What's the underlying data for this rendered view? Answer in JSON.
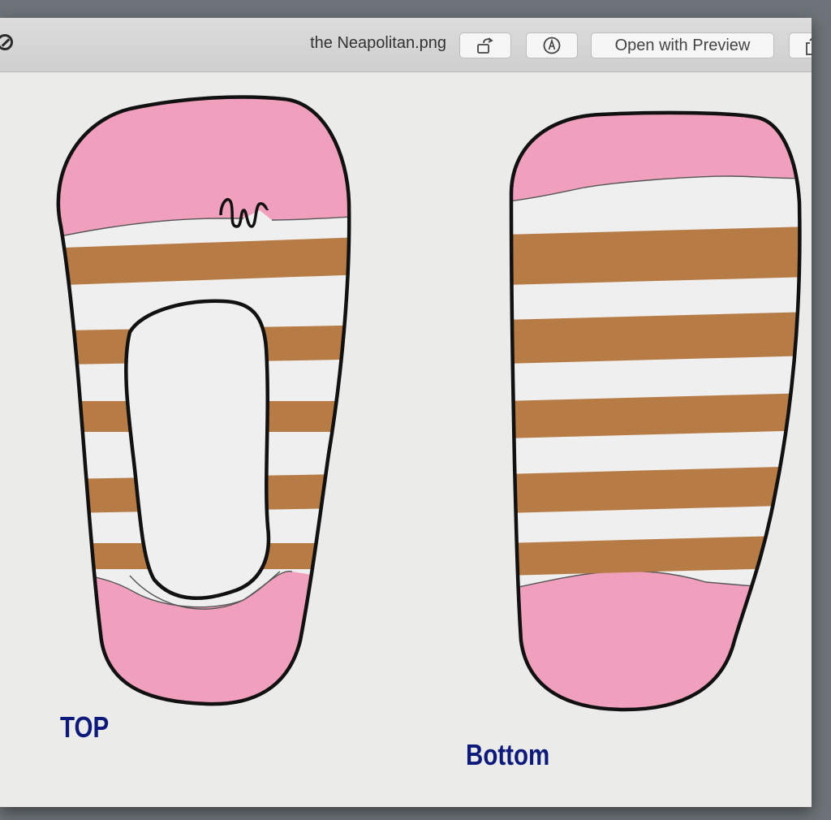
{
  "window": {
    "title": "the Neapolitan.png"
  },
  "toolbar": {
    "rotate_icon": "rotate-icon",
    "markup_icon": "markup-pen-icon",
    "open_label": "Open with Preview",
    "share_icon": "share-icon"
  },
  "drawing": {
    "top_label": "TOP",
    "bottom_label": "Bottom",
    "colors": {
      "pink": "#f0a0bd",
      "brown": "#b77b45",
      "white": "#efefef",
      "outline": "#111111",
      "label": "#0d1a7a"
    }
  }
}
